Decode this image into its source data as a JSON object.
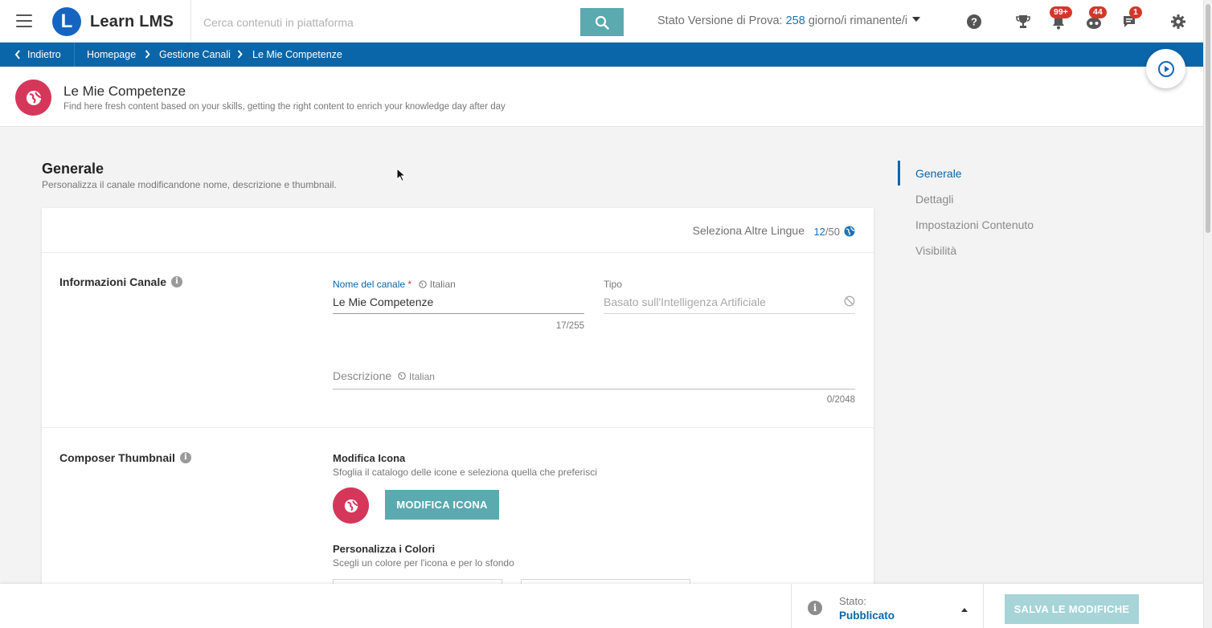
{
  "app": {
    "name": "Learn LMS",
    "logo_letter": "L"
  },
  "search": {
    "placeholder": "Cerca contenuti in piattaforma"
  },
  "trial": {
    "prefix": "Stato Versione di Prova:",
    "days": "258",
    "suffix": "giorno/i rimanente/i"
  },
  "top_icons": [
    {
      "name": "help-icon"
    },
    {
      "name": "trophy-icon"
    },
    {
      "name": "bell-icon",
      "badge": "99+"
    },
    {
      "name": "bot-icon",
      "badge": "44"
    },
    {
      "name": "chat-icon",
      "badge": "1"
    },
    {
      "name": "gear-icon"
    }
  ],
  "breadcrumb": {
    "back": "Indietro",
    "items": [
      "Homepage",
      "Gestione Canali",
      "Le Mie Competenze"
    ]
  },
  "header": {
    "title": "Le Mie Competenze",
    "subtitle": "Find here fresh content based on your skills, getting the right content to enrich your knowledge day after day"
  },
  "section": {
    "title": "Generale",
    "subtitle": "Personalizza il canale modificandone nome, descrizione e thumbnail."
  },
  "languages": {
    "label": "Seleziona Altre Lingue",
    "selected": "12",
    "total": "/50"
  },
  "channel_info": {
    "label": "Informazioni Canale",
    "name_label": "Nome del canale",
    "required_mark": "*",
    "name_lang": "Italian",
    "name_value": "Le Mie Competenze",
    "name_counter": "17/255",
    "type_label": "Tipo",
    "type_value": "Basato sull'Intelligenza Artificiale",
    "desc_label": "Descrizione",
    "desc_lang": "Italian",
    "desc_counter": "0/2048"
  },
  "composer": {
    "label": "Composer Thumbnail",
    "icon_title": "Modifica Icona",
    "icon_desc": "Sfoglia il catalogo delle icone e seleziona quella che preferisci",
    "icon_button": "MODIFICA ICONA",
    "colors_title": "Personalizza i Colori",
    "colors_desc": "Scegli un colore per l'icona e per lo sfondo"
  },
  "right_nav": [
    "Generale",
    "Dettagli",
    "Impostazioni Contenuto",
    "Visibilità"
  ],
  "footer": {
    "status_label": "Stato:",
    "status_value": "Pubblicato",
    "save_button": "SALVA LE MODIFICHE"
  },
  "colors": {
    "primary": "#0a66a8",
    "accent": "#5aaab0",
    "icon_bg": "#d5375b",
    "badge": "#d3372b"
  }
}
